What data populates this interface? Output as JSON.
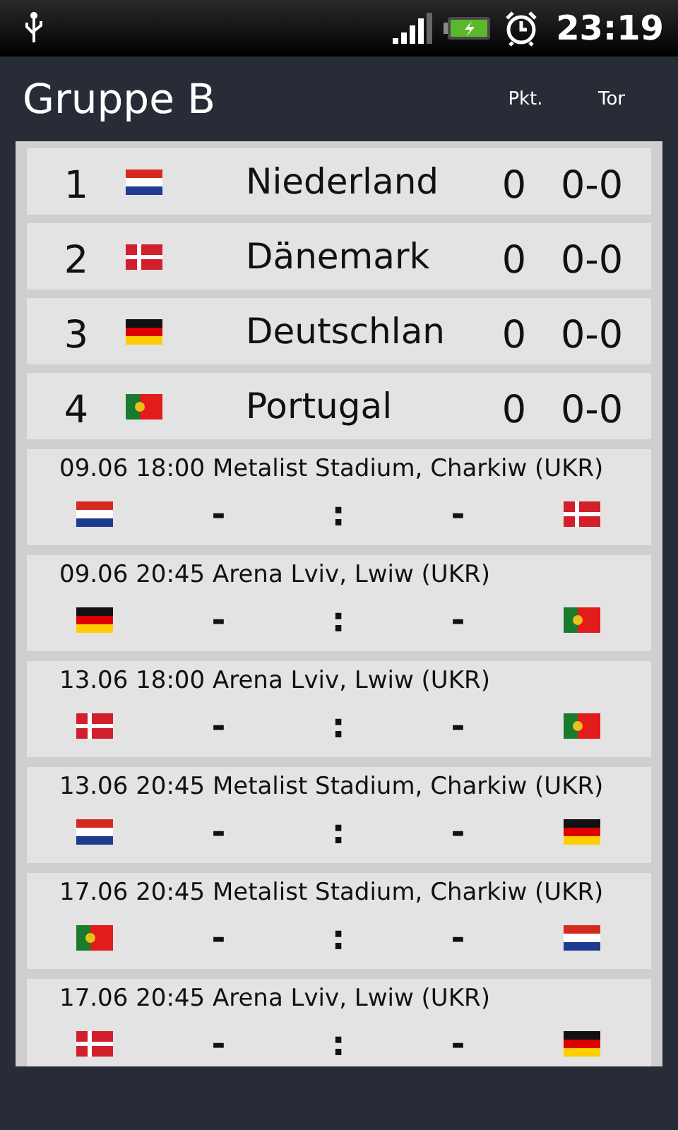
{
  "status_bar": {
    "time": "23:19"
  },
  "header": {
    "title": "Gruppe B",
    "columns": [
      "Pkt.",
      "Tor"
    ]
  },
  "standings": [
    {
      "rank": "1",
      "flag": {
        "kind": "nl"
      },
      "team": "Niederland",
      "points": "0",
      "goals": "0-0"
    },
    {
      "rank": "2",
      "flag": {
        "kind": "dk"
      },
      "team": "Dänemark",
      "points": "0",
      "goals": "0-0"
    },
    {
      "rank": "3",
      "flag": {
        "kind": "de"
      },
      "team": "Deutschlan",
      "points": "0",
      "goals": "0-0"
    },
    {
      "rank": "4",
      "flag": {
        "kind": "pt"
      },
      "team": "Portugal",
      "points": "0",
      "goals": "0-0"
    }
  ],
  "matches": [
    {
      "info": "09.06 18:00 Metalist Stadium, Charkiw (UKR)",
      "home_flag": {
        "kind": "nl"
      },
      "away_flag": {
        "kind": "dk"
      },
      "home_score": "-",
      "separator": ":",
      "away_score": "-"
    },
    {
      "info": "09.06 20:45 Arena Lviv, Lwiw (UKR)",
      "home_flag": {
        "kind": "de"
      },
      "away_flag": {
        "kind": "pt"
      },
      "home_score": "-",
      "separator": ":",
      "away_score": "-"
    },
    {
      "info": "13.06 18:00 Arena Lviv, Lwiw (UKR)",
      "home_flag": {
        "kind": "dk"
      },
      "away_flag": {
        "kind": "pt"
      },
      "home_score": "-",
      "separator": ":",
      "away_score": "-"
    },
    {
      "info": "13.06 20:45 Metalist Stadium, Charkiw (UKR)",
      "home_flag": {
        "kind": "nl"
      },
      "away_flag": {
        "kind": "de"
      },
      "home_score": "-",
      "separator": ":",
      "away_score": "-"
    },
    {
      "info": "17.06 20:45 Metalist Stadium, Charkiw (UKR)",
      "home_flag": {
        "kind": "pt"
      },
      "away_flag": {
        "kind": "nl"
      },
      "home_score": "-",
      "separator": ":",
      "away_score": "-"
    },
    {
      "info": "17.06 20:45 Arena Lviv, Lwiw (UKR)",
      "home_flag": {
        "kind": "dk"
      },
      "away_flag": {
        "kind": "de"
      },
      "home_score": "-",
      "separator": ":",
      "away_score": "-"
    }
  ]
}
